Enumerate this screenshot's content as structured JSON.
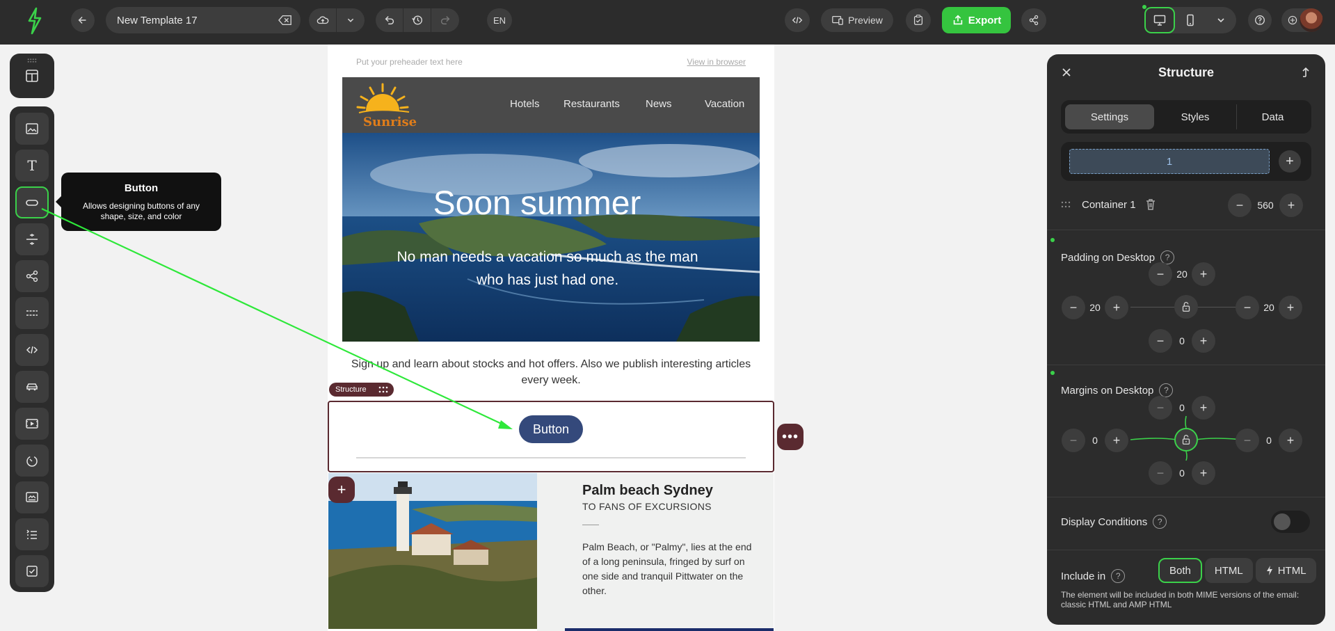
{
  "toolbar": {
    "template_name": "New Template 17",
    "language": "EN",
    "preview_label": "Preview",
    "export_label": "Export",
    "brand_color": "#35c43f"
  },
  "left_tools": {
    "icons": [
      "layout-icon",
      "image-icon",
      "text-icon",
      "button-icon",
      "spacer-icon",
      "social-icon",
      "divider-icon",
      "html-icon",
      "menu-icon",
      "video-icon",
      "timer-icon",
      "banner-icon",
      "amp-icon",
      "form-icon"
    ]
  },
  "tooltip": {
    "title": "Button",
    "description": "Allows designing buttons of any shape, size, and color"
  },
  "email": {
    "preheader": "Put your preheader text here",
    "view_in_browser": "View in browser",
    "logo_text": "Sunrise",
    "nav": [
      "Hotels",
      "Restaurants",
      "News",
      "Vacation"
    ],
    "hero_title": "Soon summer",
    "hero_subtitle": "No man needs a vacation so much as the man who has just had one.",
    "signup_text": "Sign up and learn about stocks and hot offers. Also we publish interesting articles every week.",
    "structure_tag": "Structure",
    "button_label": "Button",
    "button_color": "#34497b",
    "structure_color": "#5a2a30",
    "article_title": "Palm beach Sydney",
    "article_subtitle": "TO FANS OF EXCURSIONS",
    "article_body": "Palm Beach, or \"Palmy\", lies at the end of a long peninsula, fringed by surf on one side and tranquil Pittwater on the other."
  },
  "panel": {
    "title": "Structure",
    "tabs": [
      "Settings",
      "Styles",
      "Data"
    ],
    "active_tab": "Settings",
    "column_label": "1",
    "container_label": "Container 1",
    "container_width": "560",
    "padding": {
      "label": "Padding on Desktop",
      "top": "20",
      "left": "20",
      "right": "20",
      "bottom": "0"
    },
    "margins": {
      "label": "Margins on Desktop",
      "top": "0",
      "left": "0",
      "right": "0",
      "bottom": "0"
    },
    "display_conditions": "Display Conditions",
    "include_in": {
      "label": "Include in",
      "options": [
        "Both",
        "HTML",
        "HTML"
      ],
      "active": "Both",
      "note": "The element will be included in both MIME versions of the email: classic HTML and AMP HTML"
    }
  }
}
